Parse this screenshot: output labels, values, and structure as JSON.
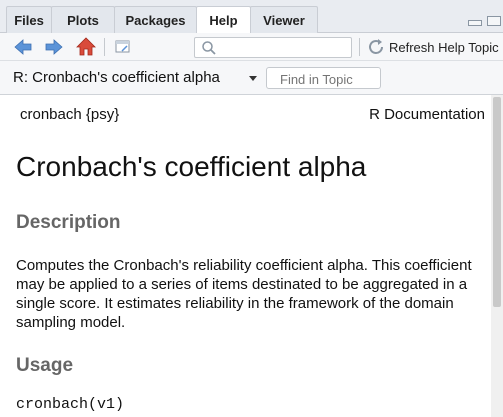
{
  "tabs": [
    {
      "label": "Files",
      "active": false
    },
    {
      "label": "Plots",
      "active": false
    },
    {
      "label": "Packages",
      "active": false
    },
    {
      "label": "Help",
      "active": true
    },
    {
      "label": "Viewer",
      "active": false
    }
  ],
  "toolbar": {
    "back_icon": "arrow-left-icon",
    "forward_icon": "arrow-right-icon",
    "home_icon": "home-icon",
    "new_window_icon": "open-in-window-icon",
    "search_icon": "magnifier-icon",
    "search_value": "",
    "refresh_icon": "refresh-icon",
    "refresh_label": "Refresh Help Topic"
  },
  "topic": {
    "title": "R: Cronbach's coefficient alpha",
    "find_placeholder": "Find in Topic"
  },
  "doc": {
    "header_left": "cronbach {psy}",
    "header_right": "R Documentation",
    "title": "Cronbach's coefficient alpha",
    "description_heading": "Description",
    "description_text": "Computes the Cronbach's reliability coefficient alpha. This coefficient may be applied to a series of items destinated to be aggregated in a single score. It estimates reliability in the framework of the domain sampling model.",
    "usage_heading": "Usage",
    "usage_code": "cronbach(v1)"
  },
  "colors": {
    "tabbar_bg": "#e9ecf1",
    "heading_gray": "#666666",
    "nav_arrow_blue": "#5b93d8",
    "home_red": "#c0392b"
  }
}
